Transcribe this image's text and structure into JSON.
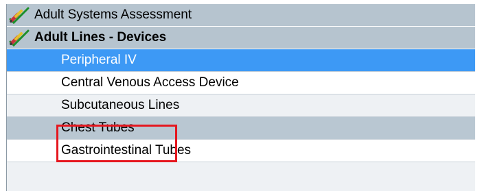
{
  "tree": {
    "groups": [
      {
        "label": "Adult Systems Assessment",
        "icon": "assessment-checkmark-icon"
      },
      {
        "label": "Adult Lines - Devices",
        "icon": "assessment-checkmark-icon"
      }
    ],
    "items": [
      {
        "label": "Peripheral IV",
        "selected": true
      },
      {
        "label": "Central Venous Access Device",
        "selected": false
      },
      {
        "label": "Subcutaneous Lines",
        "selected": false
      },
      {
        "label": "Chest Tubes",
        "selected": false,
        "annotated": true
      },
      {
        "label": "Gastrointestinal Tubes",
        "selected": false
      }
    ]
  },
  "colors": {
    "group_bg": "#b6c4cf",
    "selected_bg": "#3d99f5",
    "item_bg": "#eef1f4",
    "annotation": "#e5161e"
  }
}
